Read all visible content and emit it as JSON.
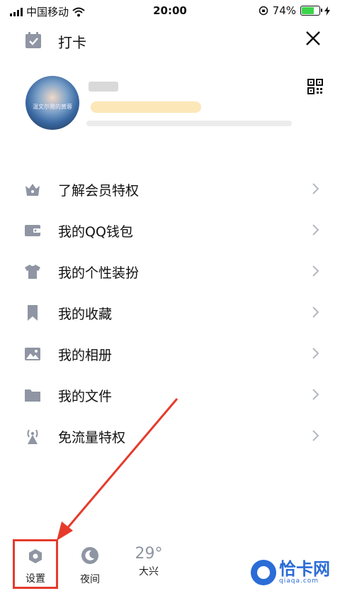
{
  "status_bar": {
    "carrier": "中国移动",
    "time": "20:00",
    "battery_percent": "74%",
    "battery_level": 0.74,
    "battery_color": "#3bd44b"
  },
  "header": {
    "title": "打卡",
    "calendar_icon": "calendar-check-icon",
    "close_icon": "close-icon"
  },
  "profile": {
    "avatar_caption": "温文尔雅的黄蓉",
    "qr_icon": "qr-code-icon"
  },
  "menu": {
    "items": [
      {
        "label": "了解会员特权",
        "icon": "crown-icon"
      },
      {
        "label": "我的QQ钱包",
        "icon": "wallet-icon"
      },
      {
        "label": "我的个性装扮",
        "icon": "tshirt-icon"
      },
      {
        "label": "我的收藏",
        "icon": "bookmark-icon"
      },
      {
        "label": "我的相册",
        "icon": "photo-icon"
      },
      {
        "label": "我的文件",
        "icon": "folder-icon"
      },
      {
        "label": "免流量特权",
        "icon": "signal-tower-icon"
      }
    ]
  },
  "bottom_bar": {
    "settings_label": "设置",
    "night_label": "夜间",
    "temperature": "29°",
    "city": "大兴",
    "highlight_color": "#e53b2c"
  },
  "watermark": {
    "brand": "恰卡网",
    "url": "qiaqa.com"
  },
  "colors": {
    "icon_gray": "#8f95a3",
    "chevron_gray": "#b5b8c0",
    "annotation_red": "#e53b2c"
  }
}
